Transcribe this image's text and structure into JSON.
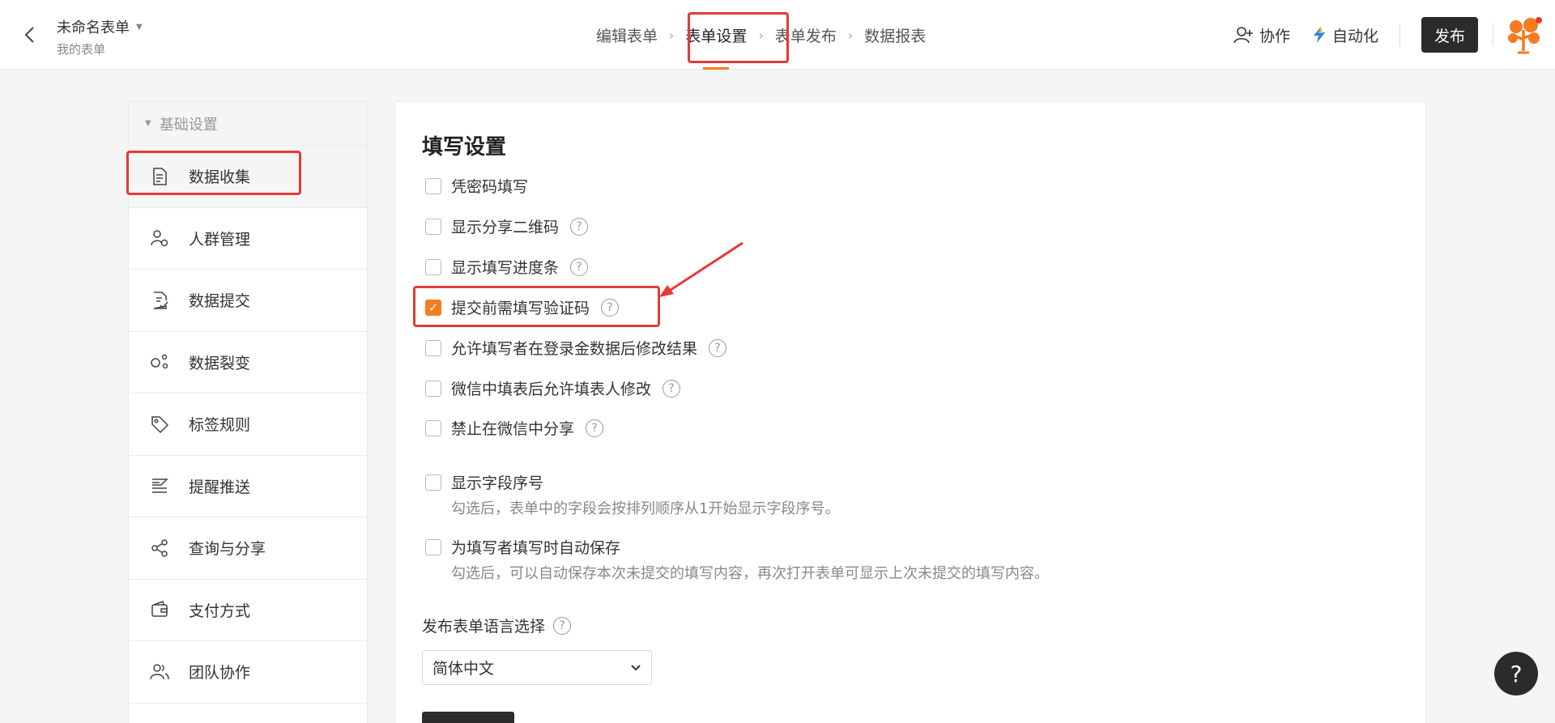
{
  "header": {
    "form_title": "未命名表单",
    "form_subtitle": "我的表单",
    "steps": [
      {
        "label": "编辑表单"
      },
      {
        "label": "表单设置"
      },
      {
        "label": "表单发布"
      },
      {
        "label": "数据报表"
      }
    ],
    "active_step": "表单设置",
    "collab_label": "协作",
    "automation_label": "自动化",
    "publish_label": "发布"
  },
  "sidebar": {
    "section_label": "基础设置",
    "items": [
      {
        "label": "数据收集",
        "icon": "document-icon"
      },
      {
        "label": "人群管理",
        "icon": "user-settings-icon"
      },
      {
        "label": "数据提交",
        "icon": "submit-document-icon"
      },
      {
        "label": "数据裂变",
        "icon": "fission-icon"
      },
      {
        "label": "标签规则",
        "icon": "tag-icon"
      },
      {
        "label": "提醒推送",
        "icon": "reminder-icon"
      },
      {
        "label": "查询与分享",
        "icon": "share-icon"
      },
      {
        "label": "支付方式",
        "icon": "wallet-icon"
      },
      {
        "label": "团队协作",
        "icon": "team-icon"
      }
    ],
    "active_item": "数据收集"
  },
  "main": {
    "title": "填写设置",
    "options": [
      {
        "label": "凭密码填写",
        "checked": false,
        "help": false
      },
      {
        "label": "显示分享二维码",
        "checked": false,
        "help": true
      },
      {
        "label": "显示填写进度条",
        "checked": false,
        "help": true
      },
      {
        "label": "提交前需填写验证码",
        "checked": true,
        "help": true
      },
      {
        "label": "允许填写者在登录金数据后修改结果",
        "checked": false,
        "help": true
      },
      {
        "label": "微信中填表后允许填表人修改",
        "checked": false,
        "help": true
      },
      {
        "label": "禁止在微信中分享",
        "checked": false,
        "help": true
      },
      {
        "label": "显示字段序号",
        "checked": false,
        "help": false
      },
      {
        "label": "为填写者填写时自动保存",
        "checked": false,
        "help": false
      }
    ],
    "desc_field_number": "勾选后，表单中的字段会按排列顺序从1开始显示字段序号。",
    "desc_auto_save": "勾选后，可以自动保存本次未提交的填写内容，再次打开表单可显示上次未提交的填写内容。",
    "language_label": "发布表单语言选择",
    "language_value": "简体中文"
  },
  "help_fab": "?",
  "colors": {
    "accent": "#f57c20",
    "annotation": "#e53935",
    "dark": "#2b2b2b"
  }
}
